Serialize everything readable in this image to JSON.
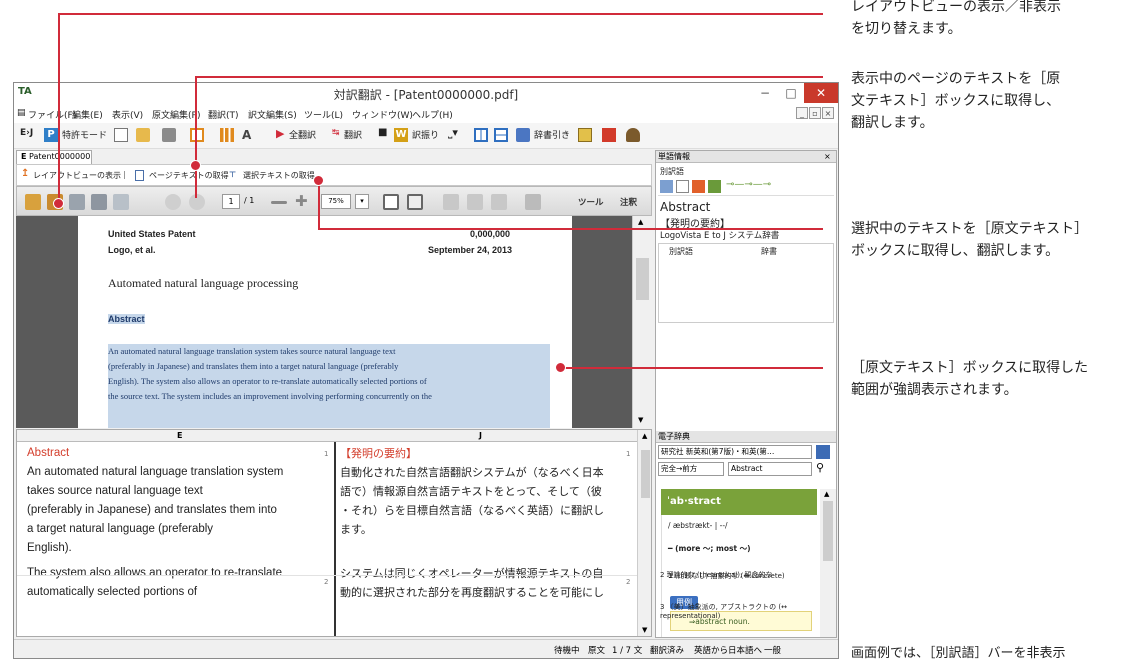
{
  "window": {
    "title": "対訳翻訳 - [Patent0000000.pdf]",
    "app_icon": "TA",
    "minimize": "−",
    "maximize": "□",
    "close": "✕"
  },
  "menu": {
    "items": [
      "ファイル(F)",
      "編集(E)",
      "表示(V)",
      "原文編集(P)",
      "翻訳(T)",
      "訳文編集(S)",
      "ツール(L)",
      "ウィンドウ(W)",
      "ヘルプ(H)"
    ],
    "mdi_buttons": [
      "_",
      "▫",
      "×"
    ]
  },
  "toolbar": {
    "direction": "E›J",
    "mode": "特許モード",
    "translate_all": "全翻訳",
    "translate": "翻訳",
    "assign": "訳振り",
    "dict_lookup": "辞書引き"
  },
  "doc_tab": {
    "label": "Patent0000000",
    "lang": "E"
  },
  "subbar": {
    "layout_view": "レイアウトビューの表示",
    "get_page_text": "ページテキストの取得",
    "get_selected_text": "選択テキストの取得"
  },
  "pdfbar": {
    "page": "1",
    "page_total": "/ 1",
    "zoom": "75%",
    "tools": "ツール",
    "notes": "注釈"
  },
  "pdf": {
    "header_left1": "United States Patent",
    "header_right1": "0,000,000",
    "header_left2": "Logo, et al.",
    "header_right2": "September 24, 2013",
    "title": "Automated natural language processing",
    "abstract_heading": "Abstract",
    "lines": [
      "An automated natural language translation system takes source natural language text",
      "(preferably in Japanese) and translates them into a target natural language (preferably",
      "English). The system also allows an operator to re-translate automatically selected portions of",
      "the source text. The system includes an improvement involving performing concurrently on the"
    ]
  },
  "grid": {
    "col_e": "E",
    "col_j": "J",
    "rows": [
      {
        "num": "1",
        "e_heading": "Abstract",
        "j_heading": "【発明の要約】",
        "e": [
          "An automated natural language translation system",
          "takes source natural language text",
          "(preferably in Japanese) and translates them into",
          "a target natural language (preferably",
          "English)."
        ],
        "j": [
          "自動化された自然言語翻訳システムが（なるべく日本",
          "語で）情報源自然言語テキストをとって、そして（彼",
          "・それ）らを目標自然言語（なるべく英語）に翻訳し",
          "ます。"
        ]
      },
      {
        "num": "2",
        "e": [
          "The system also allows an operator to re-translate",
          "automatically selected portions of"
        ],
        "j": [
          "システムは同じくオペレーターが情報源テキストの自",
          "動的に選択された部分を再度翻訳することを可能にし"
        ]
      }
    ]
  },
  "status": {
    "state": "待機中",
    "source": "原文",
    "position": "1 / 7 文",
    "translated": "翻訳済み",
    "direction": "英語から日本語へ",
    "category": "一般"
  },
  "word_panel": {
    "header": "単語情報",
    "close": "×",
    "alt_label": "別訳語",
    "source_word": "Abstract",
    "translation": "【発明の要約】",
    "dictionary_name": "LogoVista E to J システム辞書",
    "col_alt": "別訳語",
    "col_dict": "辞書"
  },
  "edict_panel": {
    "header": "電子辞典",
    "dict_select": "研究社 新英和(第7版)・和英(第…",
    "match_select": "完全→前方",
    "search_value": "Abstract",
    "headword": "ˈab·stract",
    "pron": "/ æbstrækt- | ‑‑/",
    "forms": "━ (more ～; most ～)",
    "sense1": "1 (比較なし) 抽象的な (↔ concrete)",
    "example_label": "用例",
    "example_text": "⇒abstract noun.",
    "sense2": "2 理論的な (theoretical); 観念的な",
    "sense3": "3 〔美〕抽象派の, アブストラクトの (↔ representational)"
  },
  "callouts": [
    [
      "レイアウトビューの表示／非表示",
      "を切り替えます。"
    ],
    [
      "表示中のページのテキストを［原",
      "文テキスト］ボックスに取得し、",
      "翻訳します。"
    ],
    [
      "選択中のテキストを［原文テキスト］",
      "ボックスに取得し、翻訳します。"
    ],
    [
      "［原文テキスト］ボックスに取得した",
      "範囲が強調表示されます。"
    ],
    [
      "画面例では、［別訳語］バーを非表示"
    ]
  ]
}
